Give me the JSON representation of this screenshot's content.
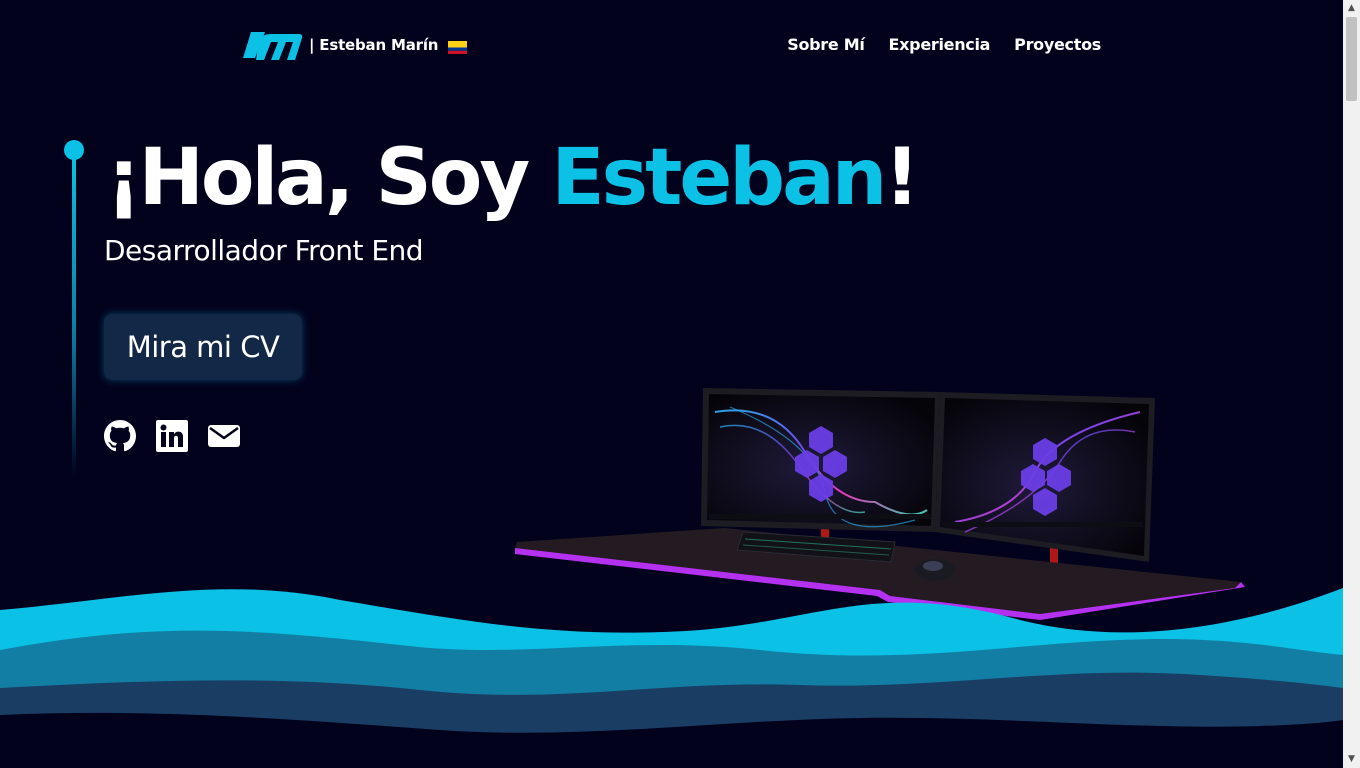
{
  "header": {
    "logo_mark": "em-logo-icon",
    "logo_name": "| Esteban Marín",
    "flag": "colombia-flag-icon",
    "nav": [
      {
        "label": "Sobre Mí"
      },
      {
        "label": "Experiencia"
      },
      {
        "label": "Proyectos"
      }
    ]
  },
  "hero": {
    "title_prefix": "¡Hola, Soy ",
    "title_name": "Esteban",
    "title_suffix": "!",
    "subtitle": "Desarrollador Front End",
    "cv_button": "Mira mi CV"
  },
  "socials": [
    {
      "icon": "github-icon"
    },
    {
      "icon": "linkedin-icon"
    },
    {
      "icon": "mail-icon"
    }
  ],
  "colors": {
    "background": "#03021d",
    "accent": "#0bc1e5",
    "button_bg": "#132746",
    "wave_light": "#0bc1e5",
    "wave_mid": "#137ea3",
    "wave_dark": "#1a3d63",
    "desk_glow": "#b431f0"
  }
}
